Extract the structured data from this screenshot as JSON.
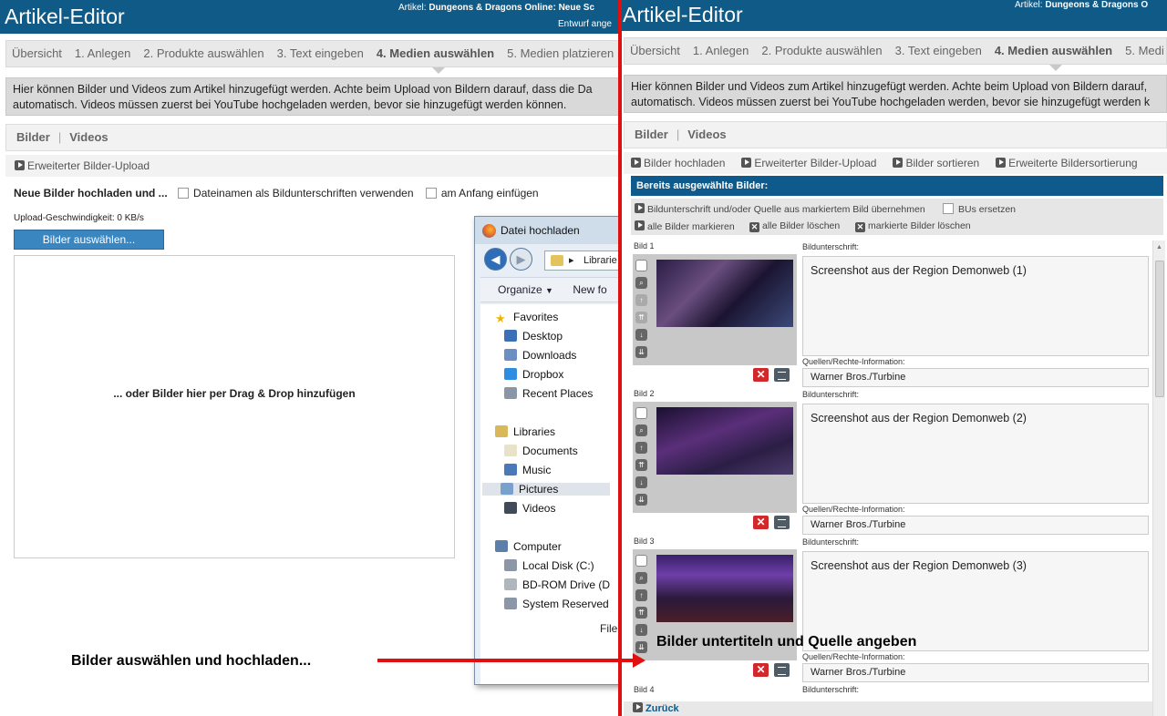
{
  "left": {
    "app_title": "Artikel-Editor",
    "article_prefix": "Artikel:",
    "article_name": "Dungeons & Dragons Online: Neue Sc",
    "draft_text": "Entwurf ange",
    "steps": [
      {
        "label": "Übersicht",
        "active": false
      },
      {
        "label": "1. Anlegen",
        "active": false
      },
      {
        "label": "2. Produkte auswählen",
        "active": false
      },
      {
        "label": "3. Text eingeben",
        "active": false
      },
      {
        "label": "4. Medien auswählen",
        "active": true
      },
      {
        "label": "5. Medien platzieren",
        "active": false
      }
    ],
    "info_line1": "Hier können Bilder und Videos zum Artikel hinzugefügt werden. Achte beim Upload von Bildern darauf, dass die Da",
    "info_line2": "automatisch. Videos müssen zuerst bei YouTube hochgeladen werden, bevor sie hinzugefügt werden können.",
    "tab_images": "Bilder",
    "tab_videos": "Videos",
    "advanced_upload": "Erweiterter Bilder-Upload",
    "upload_heading": "Neue Bilder hochladen und ...",
    "option_filenames": "Dateinamen als Bildunterschriften verwenden",
    "option_prepend": "am Anfang einfügen",
    "upload_speed": "Upload-Geschwindigkeit: 0 KB/s",
    "select_button": "Bilder auswählen...",
    "dropzone_text": "... oder Bilder hier per Drag & Drop hinzufügen",
    "annotation": "Bilder auswählen und hochladen..."
  },
  "dialog": {
    "title": "Datei hochladen",
    "address": "Librarie",
    "organize": "Organize",
    "new_folder": "New fo",
    "file_label": "File",
    "tree": [
      {
        "label": "Favorites",
        "icon": "star-icon",
        "color": "#f0b400",
        "indent": 0,
        "selected": false
      },
      {
        "label": "Desktop",
        "icon": "desktop-icon",
        "color": "#3b6fb6",
        "indent": 1,
        "selected": false
      },
      {
        "label": "Downloads",
        "icon": "downloads-icon",
        "color": "#6b8fc2",
        "indent": 1,
        "selected": false
      },
      {
        "label": "Dropbox",
        "icon": "dropbox-icon",
        "color": "#2e8de0",
        "indent": 1,
        "selected": false
      },
      {
        "label": "Recent Places",
        "icon": "recent-places-icon",
        "color": "#8a96a8",
        "indent": 1,
        "selected": false
      },
      {
        "label": "Libraries",
        "icon": "libraries-icon",
        "color": "#d9b85a",
        "indent": 0,
        "selected": false
      },
      {
        "label": "Documents",
        "icon": "documents-icon",
        "color": "#e8e2c8",
        "indent": 1,
        "selected": false
      },
      {
        "label": "Music",
        "icon": "music-icon",
        "color": "#4a78b8",
        "indent": 1,
        "selected": false
      },
      {
        "label": "Pictures",
        "icon": "pictures-icon",
        "color": "#7aa0cc",
        "indent": 1,
        "selected": true
      },
      {
        "label": "Videos",
        "icon": "videos-icon",
        "color": "#404a58",
        "indent": 1,
        "selected": false
      },
      {
        "label": "Computer",
        "icon": "computer-icon",
        "color": "#5b7eaa",
        "indent": 0,
        "selected": false
      },
      {
        "label": "Local Disk (C:)",
        "icon": "disk-icon",
        "color": "#8b97a6",
        "indent": 1,
        "selected": false
      },
      {
        "label": "BD-ROM Drive (D",
        "icon": "bd-rom-icon",
        "color": "#b0b6be",
        "indent": 1,
        "selected": false
      },
      {
        "label": "System Reserved",
        "icon": "disk-icon",
        "color": "#8b97a6",
        "indent": 1,
        "selected": false
      }
    ]
  },
  "right": {
    "app_title": "Artikel-Editor",
    "article_prefix": "Artikel:",
    "article_name": "Dungeons & Dragons O",
    "steps": [
      {
        "label": "Übersicht",
        "active": false
      },
      {
        "label": "1. Anlegen",
        "active": false
      },
      {
        "label": "2. Produkte auswählen",
        "active": false
      },
      {
        "label": "3. Text eingeben",
        "active": false
      },
      {
        "label": "4. Medien auswählen",
        "active": true
      },
      {
        "label": "5. Medi",
        "active": false
      }
    ],
    "info_line1": "Hier können Bilder und Videos zum Artikel hinzugefügt werden. Achte beim Upload von Bildern darauf,",
    "info_line2": "automatisch. Videos müssen zuerst bei YouTube hochgeladen werden, bevor sie hinzugefügt werden k",
    "tab_images": "Bilder",
    "tab_videos": "Videos",
    "actions": [
      "Bilder hochladen",
      "Erweiterter Bilder-Upload",
      "Bilder sortieren",
      "Erweiterte Bildersortierung"
    ],
    "selected_heading": "Bereits ausgewählte Bilder:",
    "take_over": "Bildunterschrift und/oder Quelle aus markiertem Bild übernehmen",
    "replace_captions": "BUs ersetzen",
    "mark_all": "alle Bilder markieren",
    "delete_all": "alle Bilder löschen",
    "delete_marked": "markierte Bilder löschen",
    "caption_label": "Bildunterschrift:",
    "source_label": "Quellen/Rechte-Information:",
    "images": [
      {
        "label": "Bild 1",
        "caption": "Screenshot aus der Region Demonweb (1)",
        "source": "Warner Bros./Turbine"
      },
      {
        "label": "Bild 2",
        "caption": "Screenshot aus der Region Demonweb (2)",
        "source": "Warner Bros./Turbine"
      },
      {
        "label": "Bild 3",
        "caption": "Screenshot aus der Region Demonweb (3)",
        "source": "Warner Bros./Turbine"
      }
    ],
    "next_image_label": "Bild 4",
    "back_link": "Zurück",
    "annotation": "Bilder untertiteln und Quelle angeben"
  }
}
